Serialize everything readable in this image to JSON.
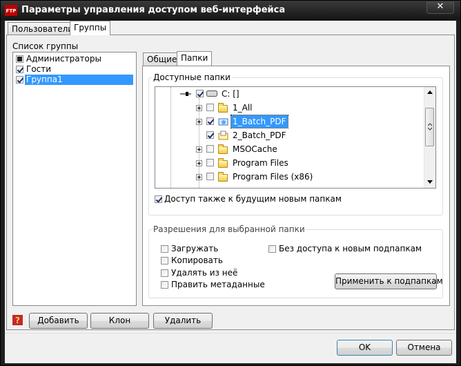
{
  "window": {
    "title": "Параметры управления доступом веб-интерфейса",
    "close_glyph": "✕",
    "app_icon_text": "FTP"
  },
  "outer_tabs": [
    {
      "label": "Пользователи"
    },
    {
      "label": "Группы"
    }
  ],
  "groups": {
    "label": "Список группы",
    "items": [
      {
        "label": "Администраторы",
        "state": "partial"
      },
      {
        "label": "Гости",
        "state": "checked"
      },
      {
        "label": "Группа1",
        "state": "checked",
        "selected": true
      }
    ]
  },
  "inner_tabs": [
    {
      "label": "Общие"
    },
    {
      "label": "Папки"
    }
  ],
  "folders": {
    "group_title": "Доступные папки",
    "root": "C: []",
    "items": [
      {
        "name": "1_All",
        "checked": false
      },
      {
        "name": "1_Batch_PDF",
        "checked": true,
        "selected": true
      },
      {
        "name": "2_Batch_PDF",
        "checked": true
      },
      {
        "name": "MSOCache",
        "checked": false
      },
      {
        "name": "Program Files",
        "checked": false
      },
      {
        "name": "Program Files (x86)",
        "checked": false
      }
    ],
    "future_access_label": "Доступ также к будущим новым папкам",
    "future_access_checked": true
  },
  "permissions": {
    "title": "Разрешения для выбранной папки",
    "upload": "Загружать",
    "copy": "Копировать",
    "delete": "Удалять из неё",
    "edit_meta": "Править метаданные",
    "no_new_subfolders": "Без доступа к новым подпапкам",
    "apply_button": "Применить к подпапкам"
  },
  "bottom": {
    "help_glyph": "?",
    "add": "Добавить",
    "clone": "Клон",
    "remove": "Удалить",
    "ok": "OK",
    "cancel": "Отмена"
  }
}
